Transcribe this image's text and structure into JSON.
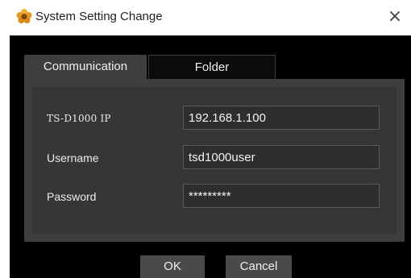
{
  "window": {
    "title": "System Setting Change",
    "close_glyph": "×",
    "icon": "gear-flower-icon",
    "icon_color": "#e8a020"
  },
  "tabs": [
    {
      "label": "Communication",
      "active": true
    },
    {
      "label": "Folder",
      "active": false
    }
  ],
  "form": {
    "ip_label": "TS-D1000 IP",
    "ip_value": "192.168.1.100",
    "username_label": "Username",
    "username_value": "tsd1000user",
    "password_label": "Password",
    "password_value": "*********"
  },
  "buttons": {
    "ok_label": "OK",
    "cancel_label": "Cancel"
  },
  "colors": {
    "dialog_bg": "#000000",
    "panel_bg": "#3e3e3e",
    "input_bg": "#2e2e2e"
  }
}
